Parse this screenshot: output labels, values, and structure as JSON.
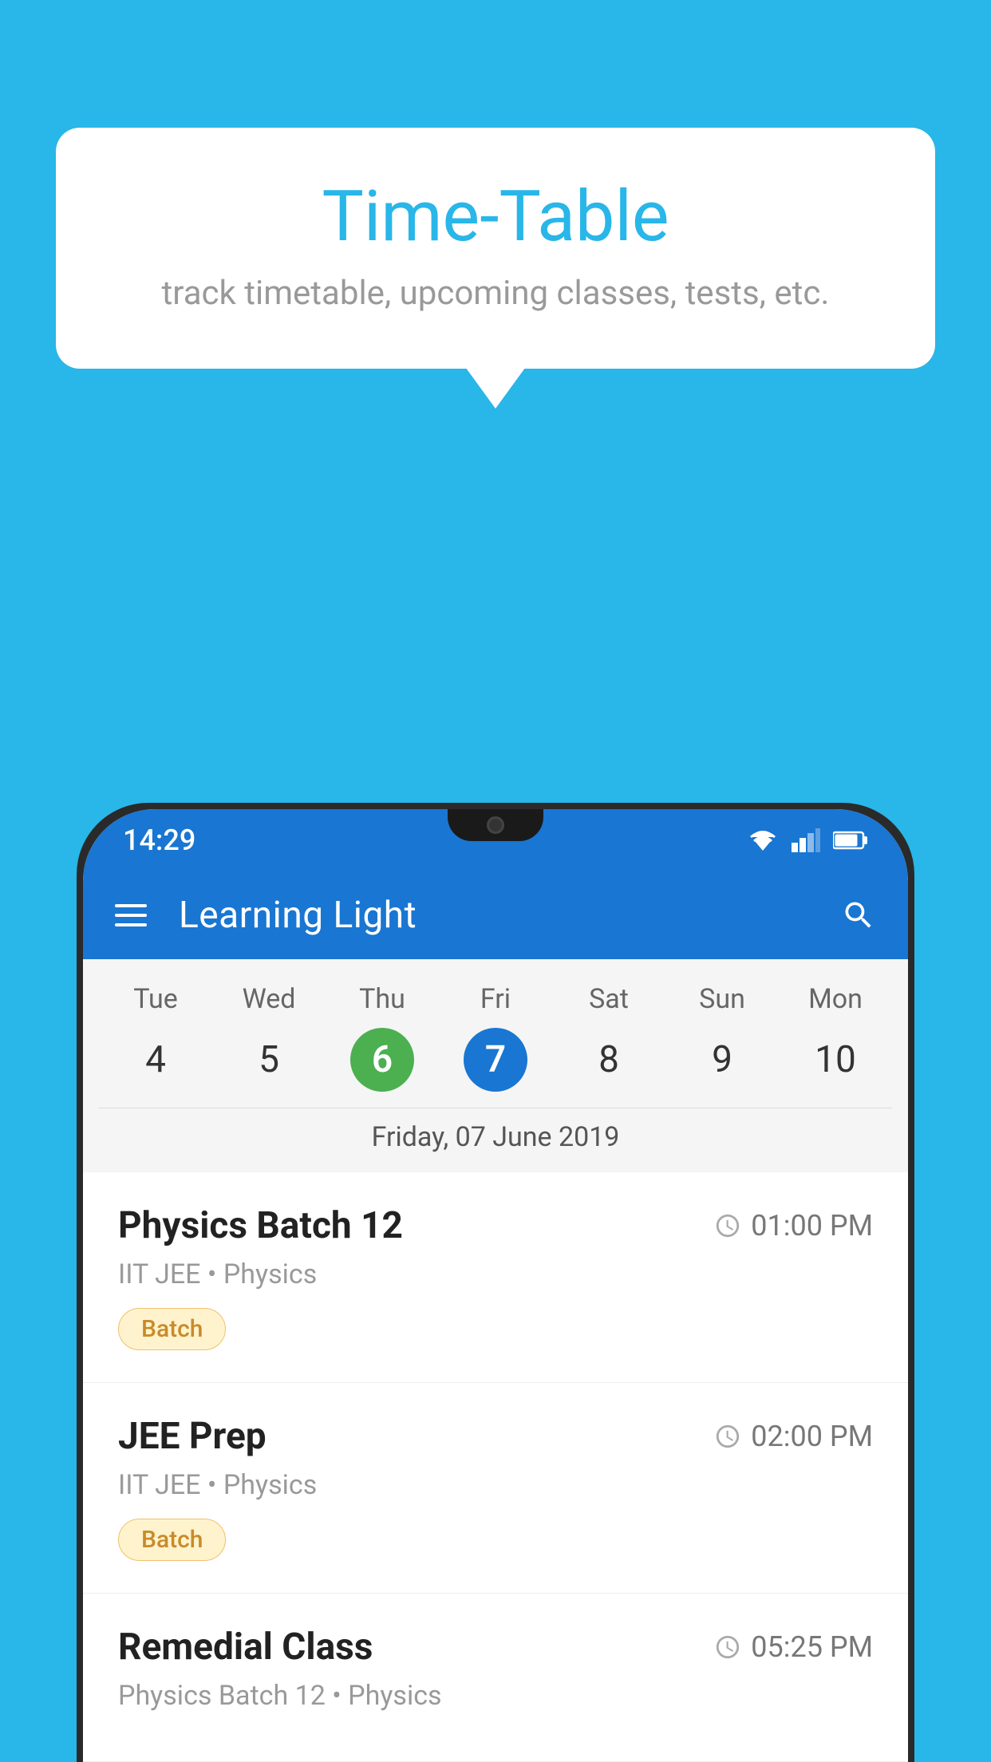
{
  "page": {
    "background_color": "#29b6e8"
  },
  "hero": {
    "title": "Time-Table",
    "subtitle": "track timetable, upcoming classes, tests, etc."
  },
  "phone": {
    "status_bar": {
      "time": "14:29"
    },
    "app_bar": {
      "title": "Learning Light"
    },
    "calendar": {
      "days": [
        "Tue",
        "Wed",
        "Thu",
        "Fri",
        "Sat",
        "Sun",
        "Mon"
      ],
      "dates": [
        4,
        5,
        6,
        7,
        8,
        9,
        10
      ],
      "today_index": 2,
      "selected_index": 3,
      "selected_label": "Friday, 07 June 2019"
    },
    "schedule": [
      {
        "title": "Physics Batch 12",
        "time": "01:00 PM",
        "subtitle": "IIT JEE • Physics",
        "badge": "Batch"
      },
      {
        "title": "JEE Prep",
        "time": "02:00 PM",
        "subtitle": "IIT JEE • Physics",
        "badge": "Batch"
      },
      {
        "title": "Remedial Class",
        "time": "05:25 PM",
        "subtitle": "Physics Batch 12 • Physics",
        "badge": null
      }
    ]
  }
}
